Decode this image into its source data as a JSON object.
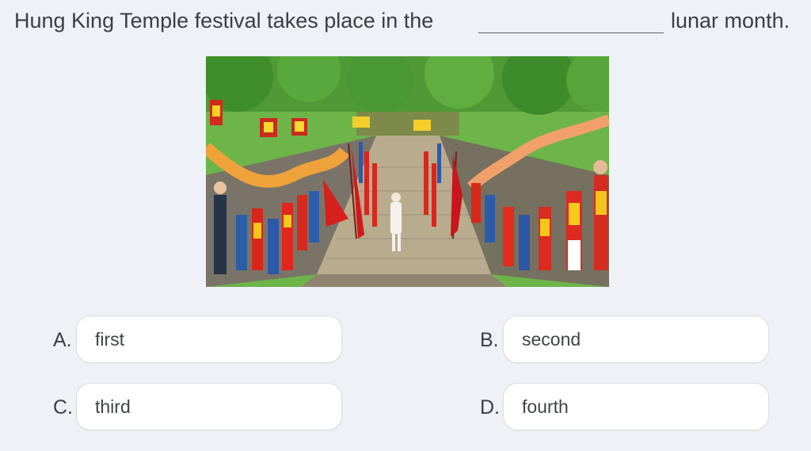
{
  "question": {
    "before_blank": "Hung King Temple festival takes place in the",
    "after_blank": "lunar month."
  },
  "picture": {
    "subject": "festival procession",
    "colors": {
      "foliage": "#5aa33a",
      "costume_red": "#d9261c",
      "costume_yellow": "#f3c21a",
      "stone_path": "#b7a98d"
    }
  },
  "options": [
    {
      "letter": "A.",
      "text": "first"
    },
    {
      "letter": "B.",
      "text": "second"
    },
    {
      "letter": "C.",
      "text": "third"
    },
    {
      "letter": "D.",
      "text": "fourth"
    }
  ]
}
